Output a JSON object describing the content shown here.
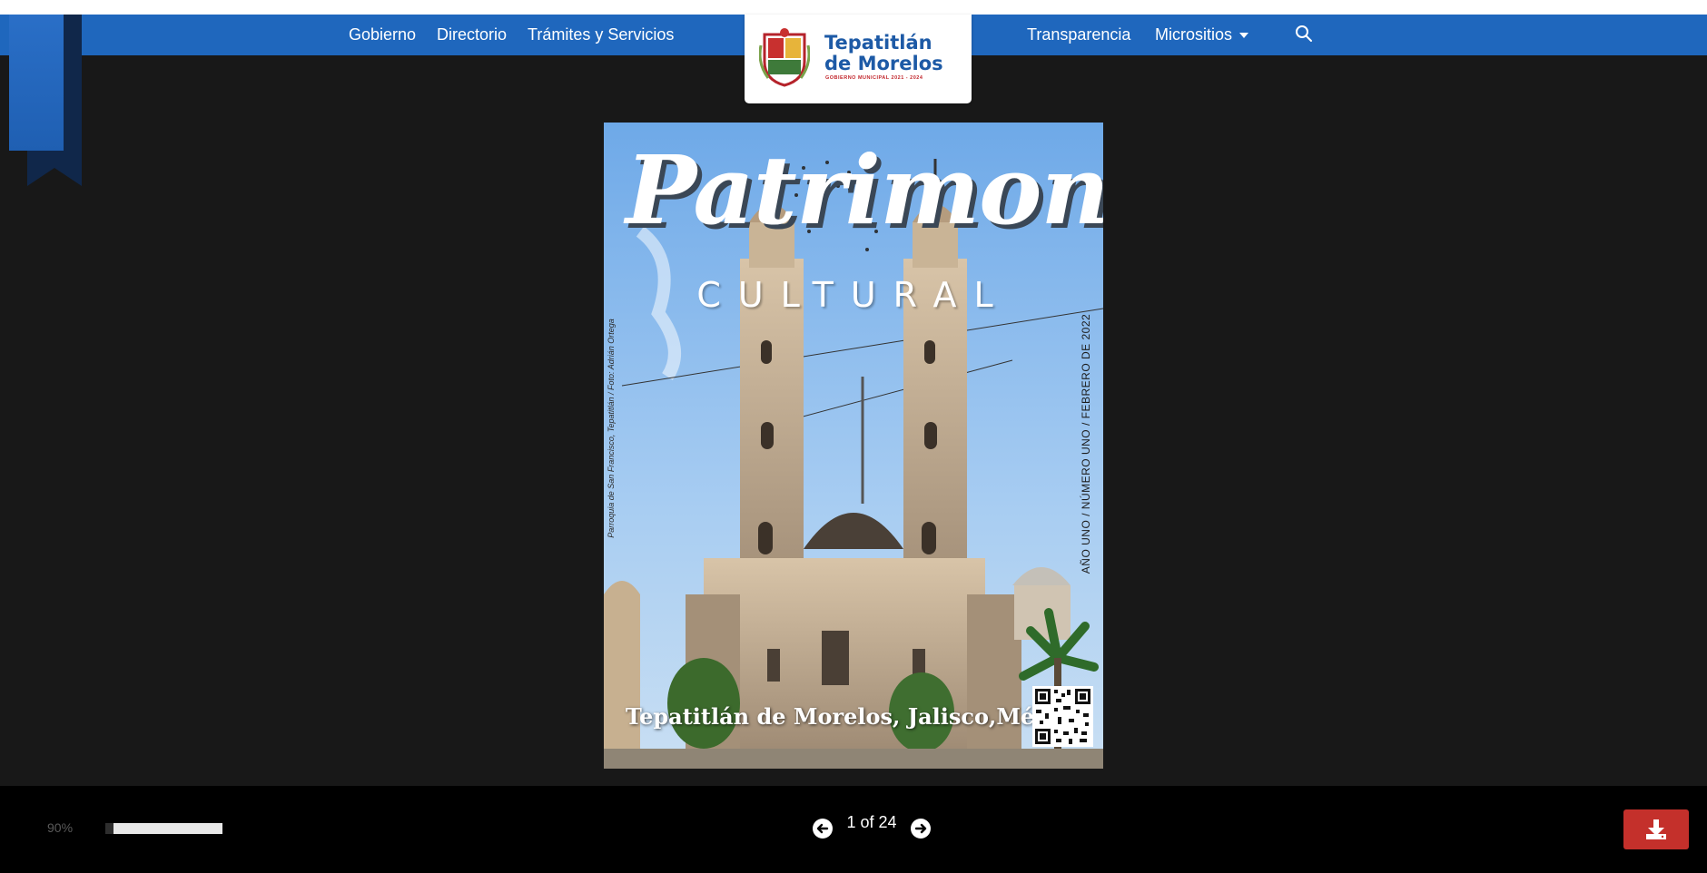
{
  "nav": {
    "left_links": [
      "Gobierno",
      "Directorio",
      "Trámites y Servicios"
    ],
    "right_links": [
      "Transparencia",
      "Micrositios"
    ],
    "search_icon": "search-icon"
  },
  "logo": {
    "line1": "Tepatitlán",
    "line2": "de Morelos",
    "subtitle": "GOBIERNO MUNICIPAL 2021 - 2024"
  },
  "cover": {
    "title": "Patrimonio",
    "subtitle": "CULTURAL",
    "issue": "AÑO UNO / NÚMERO UNO / FEBRERO DE 2022",
    "photo_credit": "Parroquia de San Francisco, Tepatitlán / Foto: Adrián Ortega",
    "location": "Tepatitlán de Morelos, Jalisco,México"
  },
  "viewer": {
    "zoom": "90%",
    "zoom_fraction": 0.07,
    "page_indicator": "1 of 24",
    "prev_icon": "arrow-left-circle-icon",
    "next_icon": "arrow-right-circle-icon",
    "download_icon": "download-icon"
  },
  "colors": {
    "navbar": "#1f67bd",
    "background": "#181818",
    "download_button": "#c4302b",
    "logo_text": "#1d5aa6"
  }
}
